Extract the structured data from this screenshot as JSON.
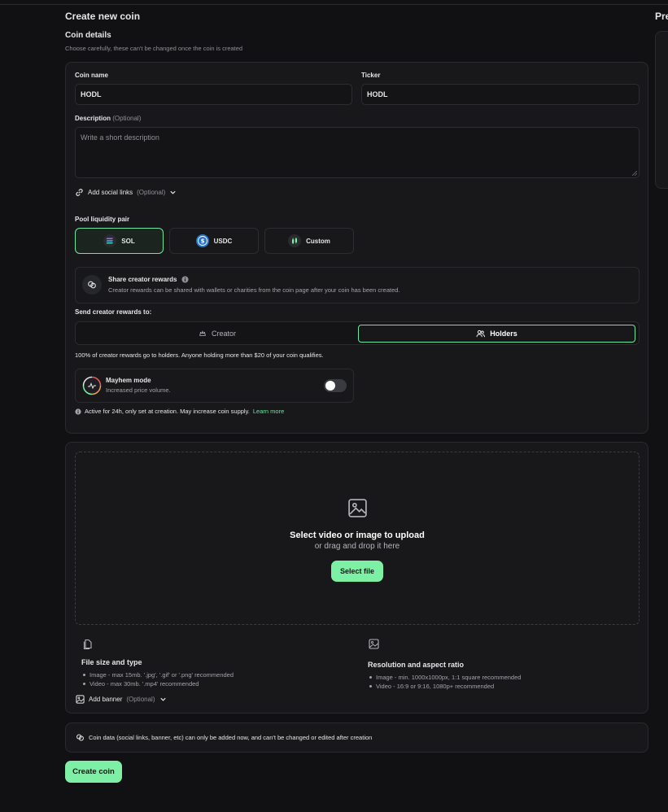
{
  "page": {
    "title": "Create new coin",
    "preview_title": "Preview"
  },
  "details": {
    "title": "Coin details",
    "subtitle": "Choose carefully, these can't be changed once the coin is created",
    "coin_name": {
      "label": "Coin name",
      "value": "HODL"
    },
    "ticker": {
      "label": "Ticker",
      "value": "HODL"
    },
    "description": {
      "label": "Description",
      "optional": "(Optional)",
      "placeholder": "Write a short description"
    },
    "social_links": {
      "label": "Add social links",
      "optional": "(Optional)"
    }
  },
  "pool": {
    "label": "Pool liquidity pair",
    "options": [
      {
        "label": "SOL",
        "icon": "solana-icon",
        "active": true
      },
      {
        "label": "USDC",
        "icon": "usdc-icon",
        "active": false
      },
      {
        "label": "Custom",
        "icon": "custom-token-icon",
        "active": false
      }
    ]
  },
  "share_rewards": {
    "title": "Share creator rewards",
    "description": "Creator rewards can be shared with wallets or charities from the coin page after your coin has been created."
  },
  "send_rewards": {
    "label": "Send creator rewards to:",
    "options": [
      {
        "label": "Creator",
        "active": false
      },
      {
        "label": "Holders",
        "active": true
      }
    ],
    "note": "100% of creator rewards go to holders. Anyone holding more than $20 of your coin qualifies."
  },
  "mayhem": {
    "title": "Mayhem mode",
    "subtitle": "Increased price volume.",
    "enabled": false,
    "note": "Active for 24h, only set at creation. May increase coin supply.",
    "learn_more": "Learn more"
  },
  "upload": {
    "title": "Select video or image to upload",
    "subtitle": "or drag and drop it here",
    "button": "Select file",
    "file_size": {
      "title": "File size and type",
      "items": [
        "Image - max 15mb. '.jpg', '.gif' or '.png' recommended",
        "Video - max 30mb. '.mp4' recommended"
      ]
    },
    "resolution": {
      "title": "Resolution and aspect ratio",
      "items": [
        "Image - min. 1000x1000px, 1:1 square recommended",
        "Video - 16:9 or 9:16, 1080p+ recommended"
      ]
    },
    "banner": {
      "label": "Add banner",
      "optional": "(Optional)"
    }
  },
  "info_note": "Coin data (social links, banner, etc) can only be added now, and can't be changed or edited after creation",
  "submit": "Create coin",
  "colors": {
    "accent": "#7ef0a5",
    "background": "#111113",
    "card": "#18181b",
    "border": "#2a2b2e"
  }
}
